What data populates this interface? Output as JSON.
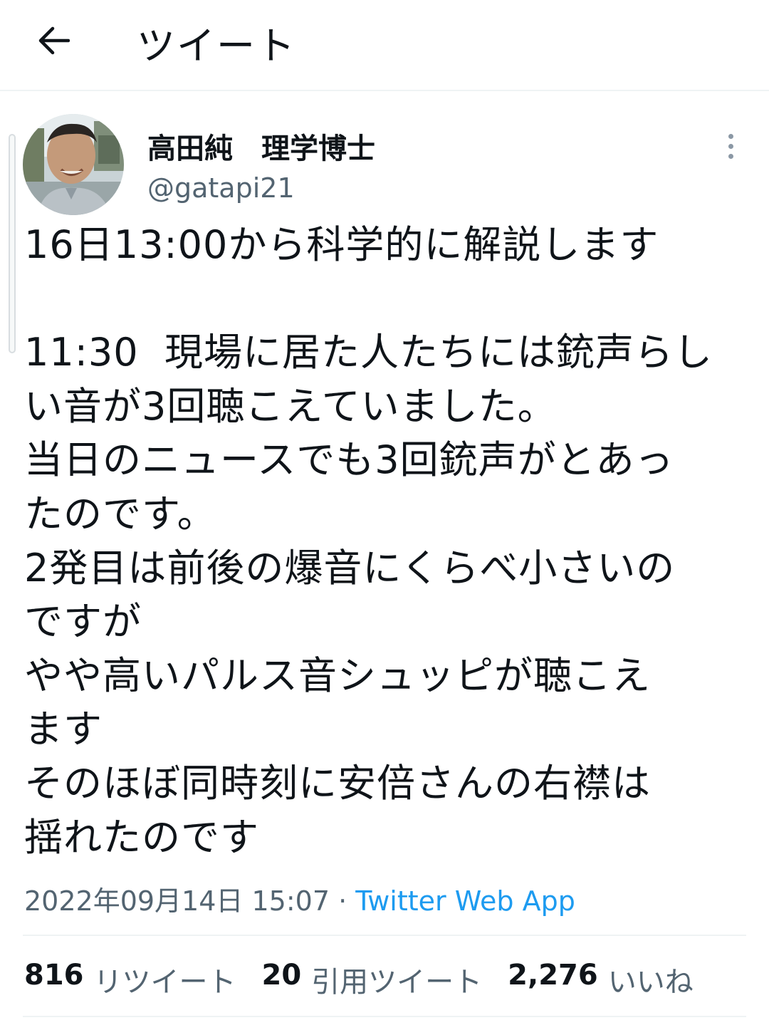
{
  "header": {
    "title": "ツイート",
    "back_icon": "arrow-left-icon"
  },
  "author": {
    "name": "高田純　理学博士",
    "handle": "@gatapi21"
  },
  "tweet": {
    "text": "16日13:00から科学的に解説します\n\n11:30  現場に居た人たちには銃声らし\nい音が3回聴こえていました。\n当日のニュースでも3回銃声がとあっ\nたのです。\n2発目は前後の爆音にくらべ小さいの\nですが\nやや高いパルス音シュッピが聴こえ\nます\nそのほぼ同時刻に安倍さんの右襟は\n揺れたのです",
    "timestamp": "2022年09月14日 15:07",
    "separator": " · ",
    "source": "Twitter Web App"
  },
  "stats": {
    "retweets": {
      "count": "816",
      "label": "リツイート"
    },
    "quotes": {
      "count": "20",
      "label": "引用ツイート"
    },
    "likes": {
      "count": "2,276",
      "label": "いいね"
    }
  },
  "colors": {
    "text": "#0f1419",
    "secondary": "#536471",
    "link": "#1d9bf0",
    "divider": "#eff3f4"
  }
}
